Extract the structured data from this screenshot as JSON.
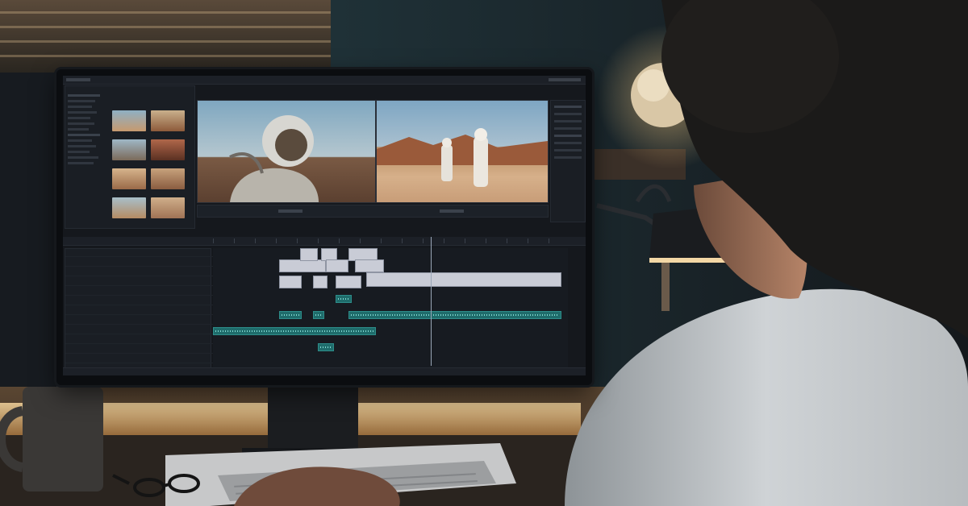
{
  "photo": {
    "scene": "person-editing-video-at-desk",
    "colors": {
      "wall": "#1d2126",
      "lamp_glow": "#f2c57c",
      "person_shirt": "#cfd3d6",
      "person_hair": "#1b1a19"
    }
  },
  "editor": {
    "accent": "#2a8f8c",
    "video_clip_color": "#c9ccd6",
    "audio_clip_color": "#1f6c6b",
    "source_viewer": "astronaut-closeup",
    "program_viewer": "two-astronauts-desert"
  }
}
